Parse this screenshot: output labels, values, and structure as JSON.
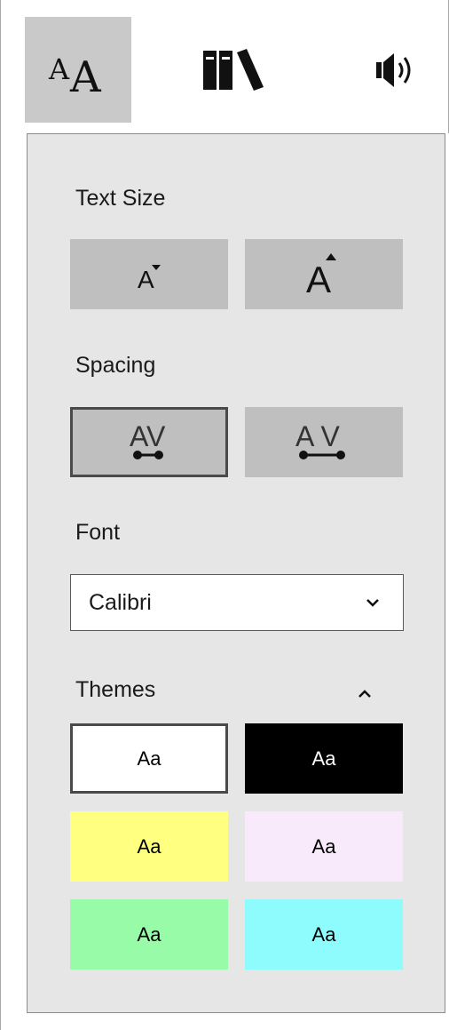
{
  "toolbar": {
    "tools": [
      {
        "icon": "text-options-icon",
        "label": "AA",
        "active": true
      },
      {
        "icon": "library-icon",
        "active": false
      },
      {
        "icon": "read-aloud-icon",
        "active": false
      }
    ]
  },
  "panel": {
    "text_size": {
      "label": "Text Size",
      "decrease_glyph": "A",
      "increase_glyph": "A"
    },
    "spacing": {
      "label": "Spacing",
      "narrow_glyph": "AV",
      "wide_glyph": "A V",
      "selected": "narrow"
    },
    "font": {
      "label": "Font",
      "value": "Calibri"
    },
    "themes": {
      "label": "Themes",
      "expanded": true,
      "items": [
        {
          "label": "Aa",
          "background": "#ffffff",
          "text_color": "#000000",
          "selected": true
        },
        {
          "label": "Aa",
          "background": "#000000",
          "text_color": "#ffffff",
          "selected": false
        },
        {
          "label": "Aa",
          "background": "#ffff80",
          "text_color": "#000000",
          "selected": false
        },
        {
          "label": "Aa",
          "background": "#f8eafa",
          "text_color": "#000000",
          "selected": false
        },
        {
          "label": "Aa",
          "background": "#98fba8",
          "text_color": "#000000",
          "selected": false
        },
        {
          "label": "Aa",
          "background": "#8efbfd",
          "text_color": "#000000",
          "selected": false
        }
      ]
    }
  },
  "colors": {
    "panel_bg": "#e6e6e6",
    "button_bg": "#bfbfbf",
    "active_tool_bg": "#c9c9c9",
    "selected_border": "#4a4a4a"
  }
}
